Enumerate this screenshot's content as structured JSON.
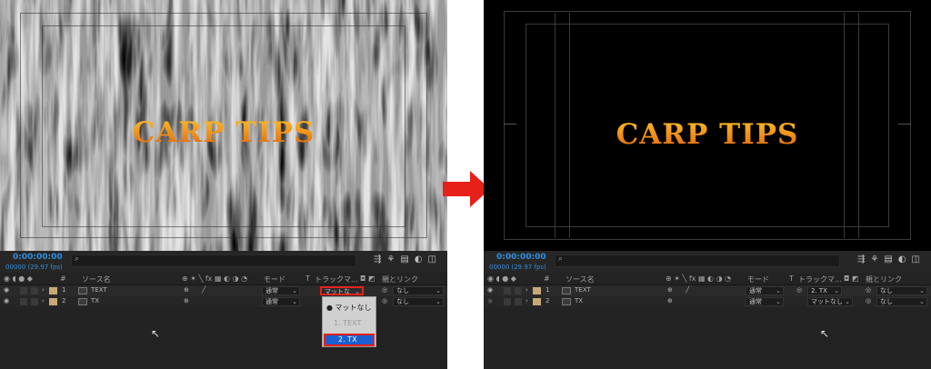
{
  "left": {
    "viewer": {
      "title_text": "CARP TIPS"
    },
    "timeline": {
      "timecode": "0:00:00:00",
      "fps": "00000 (29.97 fps)",
      "search_icon": "search-icon",
      "columns": {
        "source_name": "ソース名",
        "mode": "モード",
        "t": "T",
        "track_matte": "トラックマ...",
        "parent_link": "親とリンク",
        "hash": "#"
      },
      "layers": [
        {
          "num": "1",
          "name": "TEXT",
          "mode": "通常",
          "matte": "マットな",
          "parent": "なし"
        },
        {
          "num": "2",
          "name": "TX",
          "mode": "通常",
          "matte": "",
          "parent": "なし"
        }
      ],
      "matte_menu": {
        "items": [
          "● マットなし",
          "1. TEXT",
          "2. TX"
        ]
      }
    }
  },
  "right": {
    "viewer": {
      "title_text": "CARP TIPS"
    },
    "timeline": {
      "timecode": "0:00:00:00",
      "fps": "00000 (29.97 fps)",
      "columns": {
        "source_name": "ソース名",
        "mode": "モード",
        "t": "T",
        "track_matte": "トラックマ...",
        "parent_link": "親とリンク",
        "hash": "#"
      },
      "layers": [
        {
          "num": "1",
          "name": "TEXT",
          "mode": "通常",
          "matte": "2. TX",
          "parent": "なし"
        },
        {
          "num": "2",
          "name": "TX",
          "mode": "通常",
          "matte": "マットなし",
          "parent": "なし"
        }
      ]
    }
  },
  "arrow": {
    "color": "#e8201a"
  },
  "accent": "#2f8fe0"
}
